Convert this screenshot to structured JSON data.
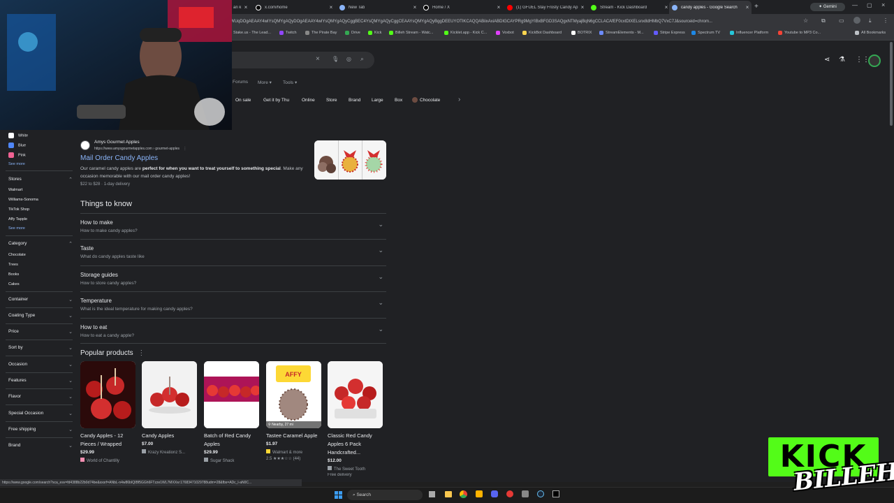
{
  "browser": {
    "tabs": [
      {
        "label": "an k",
        "color": "#888"
      },
      {
        "label": "x.com/home",
        "color": "#fff"
      },
      {
        "label": "New Tab",
        "color": "#8ab4f8"
      },
      {
        "label": "Home / X",
        "color": "#fff"
      },
      {
        "label": "(1) GFUEL Stay Frosty Candy Ap",
        "color": "#ff0000"
      },
      {
        "label": "Stream - Kick Dashboard",
        "color": "#53fc18"
      },
      {
        "label": "candy apples - Google Search",
        "color": "#8ab4f8"
      }
    ],
    "new_tab": "+",
    "gemini": "Gemini",
    "url": "WUqDOgAEAAY4wIYsQMYgAQyDOgAEAAY4wIYsQMYgAQyCggBEC4YsQMYgAQyCggCEAAYsQMYgAQyBggDEEUYOTIKCAQQABiixAxiABDIGCAYPRg9MgYIBxBFGD3SAQgxNTMyajBqN6gCCLACAfEF0cxtDtXELsnx8dHMbQ7VxC7J&sourceid=chrom...",
    "bookmarks": [
      "Stake.us - The Lead...",
      "Twitch",
      "The Pirate Bay",
      "Drive",
      "Kick",
      "Billeh Stream - Watc...",
      "Kicklet.app - Kick C...",
      "Voxbot",
      "KickBot Dashboard",
      "BOTRIX",
      "StreamElements - M...",
      "Stripe Express",
      "Spectrum TV",
      "Influencer Platform",
      "Youtube to MP3 Co...",
      "All Bookmarks"
    ]
  },
  "search": {
    "nav": [
      "Forums",
      "More",
      "Tools"
    ],
    "chips": [
      "On sale",
      "Get it by Thu",
      "Online",
      "Store",
      "Brand",
      "Large",
      "Box",
      "Chocolate"
    ]
  },
  "sidebar": {
    "colors": [
      {
        "label": "White",
        "color": "#ffffff"
      },
      {
        "label": "Blue",
        "color": "#4f86f7"
      },
      {
        "label": "Pink",
        "color": "#f06292"
      }
    ],
    "see_more": "See more",
    "stores_title": "Stores",
    "stores": [
      "Walmart",
      "Williams-Sonoma",
      "TikTok Shop",
      "Affy Tapple"
    ],
    "category_title": "Category",
    "categories": [
      "Chocolate",
      "Trees",
      "Books",
      "Cakes"
    ],
    "filters": [
      "Container",
      "Coating Type",
      "Price",
      "Sort by",
      "Occasion",
      "Features",
      "Flavor",
      "Special Occasion",
      "Free shipping",
      "Brand"
    ]
  },
  "result": {
    "site": "Amys Gourmet Apples",
    "url": "https://www.amysgourmetapples.com › gourmet-apples",
    "title": "Mail Order Candy Apples",
    "snippet_a": "Our caramel candy apples are ",
    "snippet_b": "perfect for when you want to treat yourself to something special",
    "snippet_c": ". Make any occasion memorable with our mail order candy apples!",
    "meta": "$22 to $28 · 1-day delivery"
  },
  "things": {
    "title": "Things to know",
    "items": [
      {
        "q": "How to make",
        "a": "How to make candy apples?"
      },
      {
        "q": "Taste",
        "a": "What do candy apples taste like"
      },
      {
        "q": "Storage guides",
        "a": "How to store candy apples?"
      },
      {
        "q": "Temperature",
        "a": "What is the ideal temperature for making candy apples?"
      },
      {
        "q": "How to eat",
        "a": "How to eat a candy apple?"
      }
    ]
  },
  "products": {
    "title": "Popular products",
    "items": [
      {
        "name": "Candy Apples - 12 Pieces / Wrapped",
        "price": "$29.99",
        "store": "World of Chantilly",
        "extra": "",
        "badge": ""
      },
      {
        "name": "Candy Apples",
        "price": "$7.00",
        "store": "Krazy Kreationz S...",
        "extra": "",
        "badge": ""
      },
      {
        "name": "Batch of Red Candy Apples",
        "price": "$29.99",
        "store": "Sugar Shack",
        "extra": "",
        "badge": ""
      },
      {
        "name": "Tastee Caramel Apple",
        "price": "$1.97",
        "store": "Walmart & more",
        "extra": "2.5 ★★★☆☆ (44)",
        "badge": "Nearby, 27 mi"
      },
      {
        "name": "Classic Red Candy Apples 6 Pack Handcrafted...",
        "price": "$12.00",
        "store": "The Sweet Tooth",
        "extra": "Free delivery",
        "badge": ""
      }
    ]
  },
  "status_url": "https://www.google.com/search?sca_esv=fd4388b22b0d74be&sxsrf=ANbL-n4w86bIQIBf5GGh6FTzze1WL7MXXw:17683471029788udm=28&fbs=ADc_l-aN0C...",
  "taskbar": {
    "search": "Search"
  },
  "overlay": {
    "kick": "KICK",
    "billeh": "BILLEH"
  }
}
